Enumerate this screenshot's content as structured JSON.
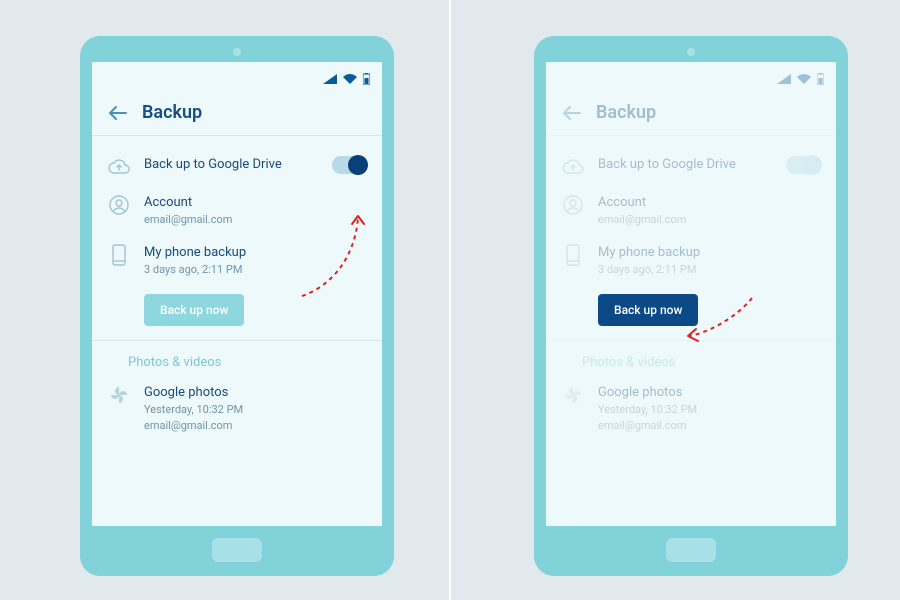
{
  "header": {
    "title": "Backup"
  },
  "backup": {
    "drive_label": "Back up to Google Drive",
    "account_label": "Account",
    "account_value": "email@gmail.com",
    "phone_label": "My phone backup",
    "phone_value": "3 days ago, 2:11 PM",
    "button_label": "Back up now"
  },
  "photos": {
    "section_title": "Photos & videos",
    "photos_label": "Google photos",
    "photos_time": "Yesterday, 10:32 PM",
    "photos_account": "email@gmail.com"
  }
}
